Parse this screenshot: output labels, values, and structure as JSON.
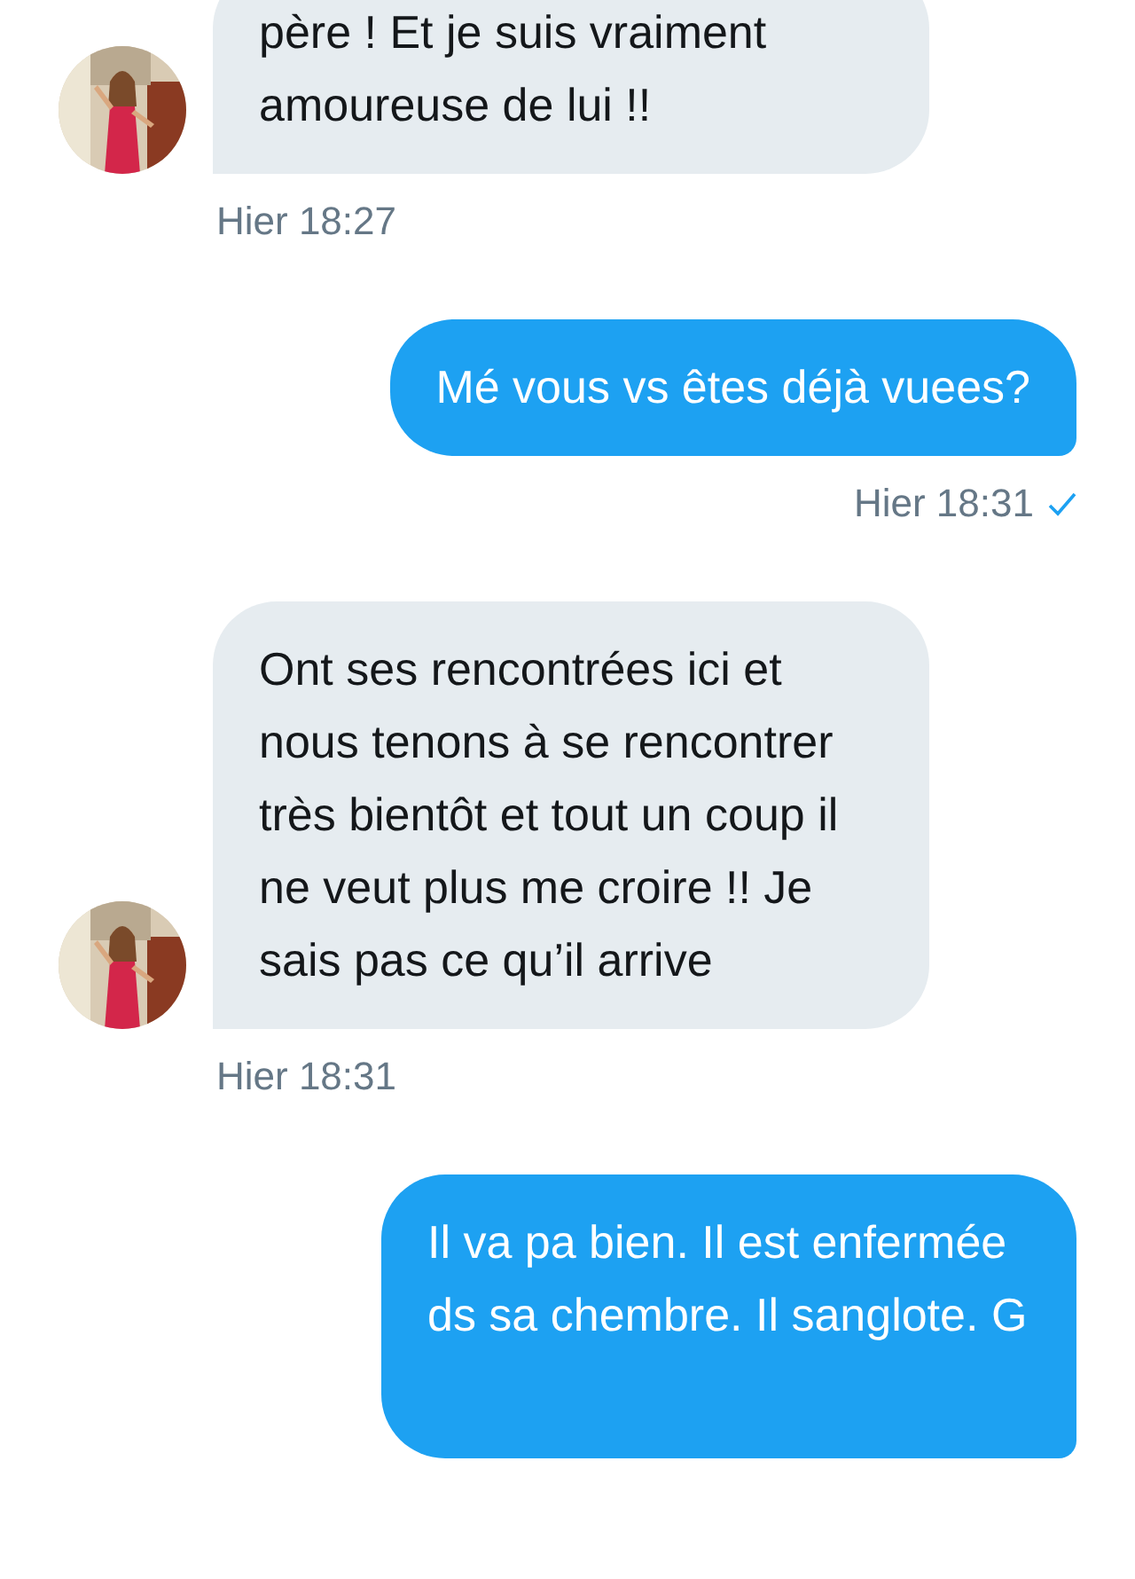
{
  "messages": [
    {
      "kind": "received",
      "text": "père ! Et je suis vraiment amoureuse de lui !!",
      "time": "Hier 18:27"
    },
    {
      "kind": "sent",
      "text": "Mé vous vs êtes déjà vuees?",
      "time": "Hier 18:31",
      "read": true
    },
    {
      "kind": "received",
      "text": "Ont ses rencontrées ici et nous tenons à se rencontrer très bientôt et tout un coup il ne veut plus me croire !! Je sais pas ce qu’il arrive",
      "time": "Hier 18:31"
    },
    {
      "kind": "sent",
      "text": "Il va pa bien. Il est enfermée ds sa chembre. Il sanglote. G"
    }
  ]
}
